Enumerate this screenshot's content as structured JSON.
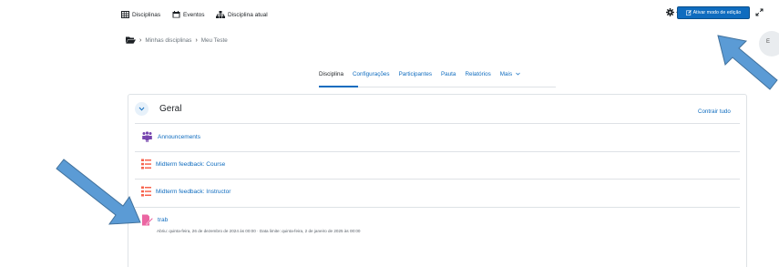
{
  "topnav": {
    "disciplinas": "Disciplinas",
    "eventos": "Eventos",
    "disciplina_atual": "Disciplina atual"
  },
  "header": {
    "edit_mode_label": "Ativar modo de edição",
    "side_button_label": "E"
  },
  "breadcrumb": {
    "items": [
      "Minhas disciplinas",
      "Meu Teste"
    ]
  },
  "tabs": {
    "items": [
      "Disciplina",
      "Configurações",
      "Participantes",
      "Pauta",
      "Relatórios",
      "Mais"
    ]
  },
  "section": {
    "title": "Geral",
    "collapse_all": "Contrair tudo"
  },
  "activities": [
    {
      "label": "Announcements",
      "icon": "forum-icon",
      "color": "#7645ae"
    },
    {
      "label": "Midterm feedback: Course",
      "icon": "feedback-icon",
      "color": "#f7634d"
    },
    {
      "label": "Midterm feedback: Instructor",
      "icon": "feedback-icon",
      "color": "#f7634d"
    },
    {
      "label": "trab",
      "icon": "assignment-icon",
      "color": "#eb66a2"
    }
  ],
  "assignment_dates": "Abriu: quinta-feira, 26 de dezembro de 2024 às 00:00 · Data limite: quinta-feira, 2 de janeiro de 2025 às 00:00",
  "colors": {
    "primary": "#0f6cbf",
    "annotation_arrow": "#5b9bd5"
  }
}
